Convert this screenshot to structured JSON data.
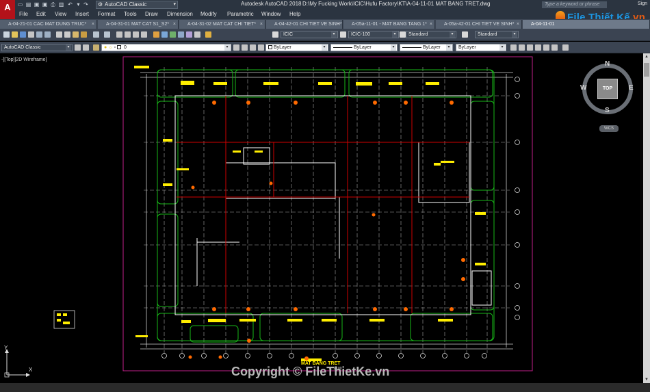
{
  "titlebar": {
    "app_name": "Autodesk AutoCAD 2018",
    "file_path": "D:\\My Fucking Work\\ICIC\\Hufu Factory\\KT\\A-04-11-01 MAT BANG TRET.dwg",
    "workspace": "AutoCAD Classic",
    "search_placeholder": "Type a keyword or phrase",
    "sign_in": "Sign"
  },
  "app_icon": "A",
  "menu": [
    "File",
    "Edit",
    "View",
    "Insert",
    "Format",
    "Tools",
    "Draw",
    "Dimension",
    "Modify",
    "Parametric",
    "Window",
    "Help"
  ],
  "tabs": [
    {
      "label": "A-04-21-01 CAC MAT DUNG TRUC*"
    },
    {
      "label": "A-04-31-01 MAT CAT S1_S2*"
    },
    {
      "label": "A-04-31-02 MAT CAT CHI TIET*"
    },
    {
      "label": "A-04-42-01 CHI TIET VE SINH*"
    },
    {
      "label": "A-05a-11-01 - MAT BANG TANG 1*"
    },
    {
      "label": "A-05a-42-01 CHI TIET VE SINH*"
    },
    {
      "label": "A-04-11-01"
    }
  ],
  "toolbar1": {
    "text_style": "ICIC",
    "dim_style": "ICIC-100",
    "table_style": "Standard",
    "mleader_style": "Standard"
  },
  "toolbar2": {
    "workspace": "AutoCAD Classic",
    "layer": "0",
    "color": "ByLayer",
    "linetype": "ByLayer",
    "lineweight": "ByLayer",
    "plotstyle": "ByLayer"
  },
  "viewport_label": "-][Top][2D Wireframe]",
  "viewcube": {
    "north": "N",
    "south": "S",
    "east": "E",
    "west": "W",
    "face": "TOP",
    "wcs": "WCS"
  },
  "drawing": {
    "title": "MAT BANG TRET",
    "scale": "TL 1/100"
  },
  "ucs": {
    "x": "X",
    "y": "Y"
  },
  "brand": {
    "part1": "File",
    "part2": "Thiết",
    "part3": "Kế",
    "part4": ".vn"
  },
  "copyright": "Copyright © FileThietKe.vn",
  "colors": {
    "layout_border": "#c0208a",
    "wall": "#ffffff",
    "grid": "#c8c8c8",
    "red_line": "#d00000",
    "green": "#18b818",
    "yellow_text": "#ffee00",
    "orange_marker": "#ff6a00"
  }
}
